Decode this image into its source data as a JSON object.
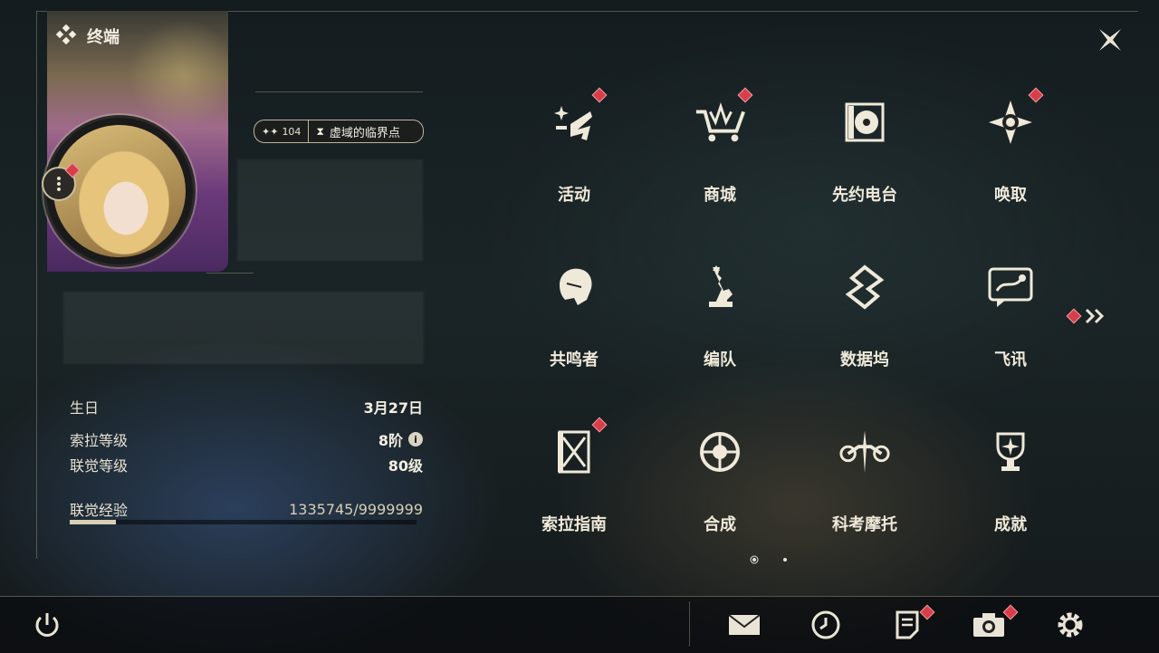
{
  "header": {
    "section_title": "终端"
  },
  "profile": {
    "level": "104",
    "title_name": "虚域的临界点",
    "stats": [
      {
        "label": "生日",
        "value": "3月27日"
      },
      {
        "label": "索拉等级",
        "value": "8阶"
      },
      {
        "label": "联觉等级",
        "value": "80级"
      }
    ],
    "exp": {
      "label": "联觉经验",
      "value": "1335745/9999999",
      "progress": 0.1336
    }
  },
  "grid": {
    "items": [
      {
        "label": "活动",
        "icon": "sparkle-activity-icon",
        "badge": true
      },
      {
        "label": "商城",
        "icon": "shop-cart-icon",
        "badge": true
      },
      {
        "label": "先约电台",
        "icon": "radio-record-icon",
        "badge": false
      },
      {
        "label": "唤取",
        "icon": "compass-star-icon",
        "badge": true
      },
      {
        "label": "共鸣者",
        "icon": "character-head-icon",
        "badge": false
      },
      {
        "label": "编队",
        "icon": "chess-team-icon",
        "badge": false
      },
      {
        "label": "数据坞",
        "icon": "data-dock-icon",
        "badge": false
      },
      {
        "label": "飞讯",
        "icon": "chat-message-icon",
        "badge": false
      },
      {
        "label": "索拉指南",
        "icon": "guide-book-icon",
        "badge": true
      },
      {
        "label": "合成",
        "icon": "synthesis-icon",
        "badge": false
      },
      {
        "label": "科考摩托",
        "icon": "motorbike-icon",
        "badge": false
      },
      {
        "label": "成就",
        "icon": "trophy-icon",
        "badge": false
      }
    ],
    "page_current": 1,
    "page_total": 2
  },
  "bottom_bar": {
    "buttons": [
      "power-icon",
      "mail-icon",
      "clock-icon",
      "notes-icon",
      "camera-icon",
      "settings-gear-icon"
    ]
  },
  "colors": {
    "accent": "#d83e4a",
    "text": "#efe9da",
    "frame": "#bdb59a"
  }
}
